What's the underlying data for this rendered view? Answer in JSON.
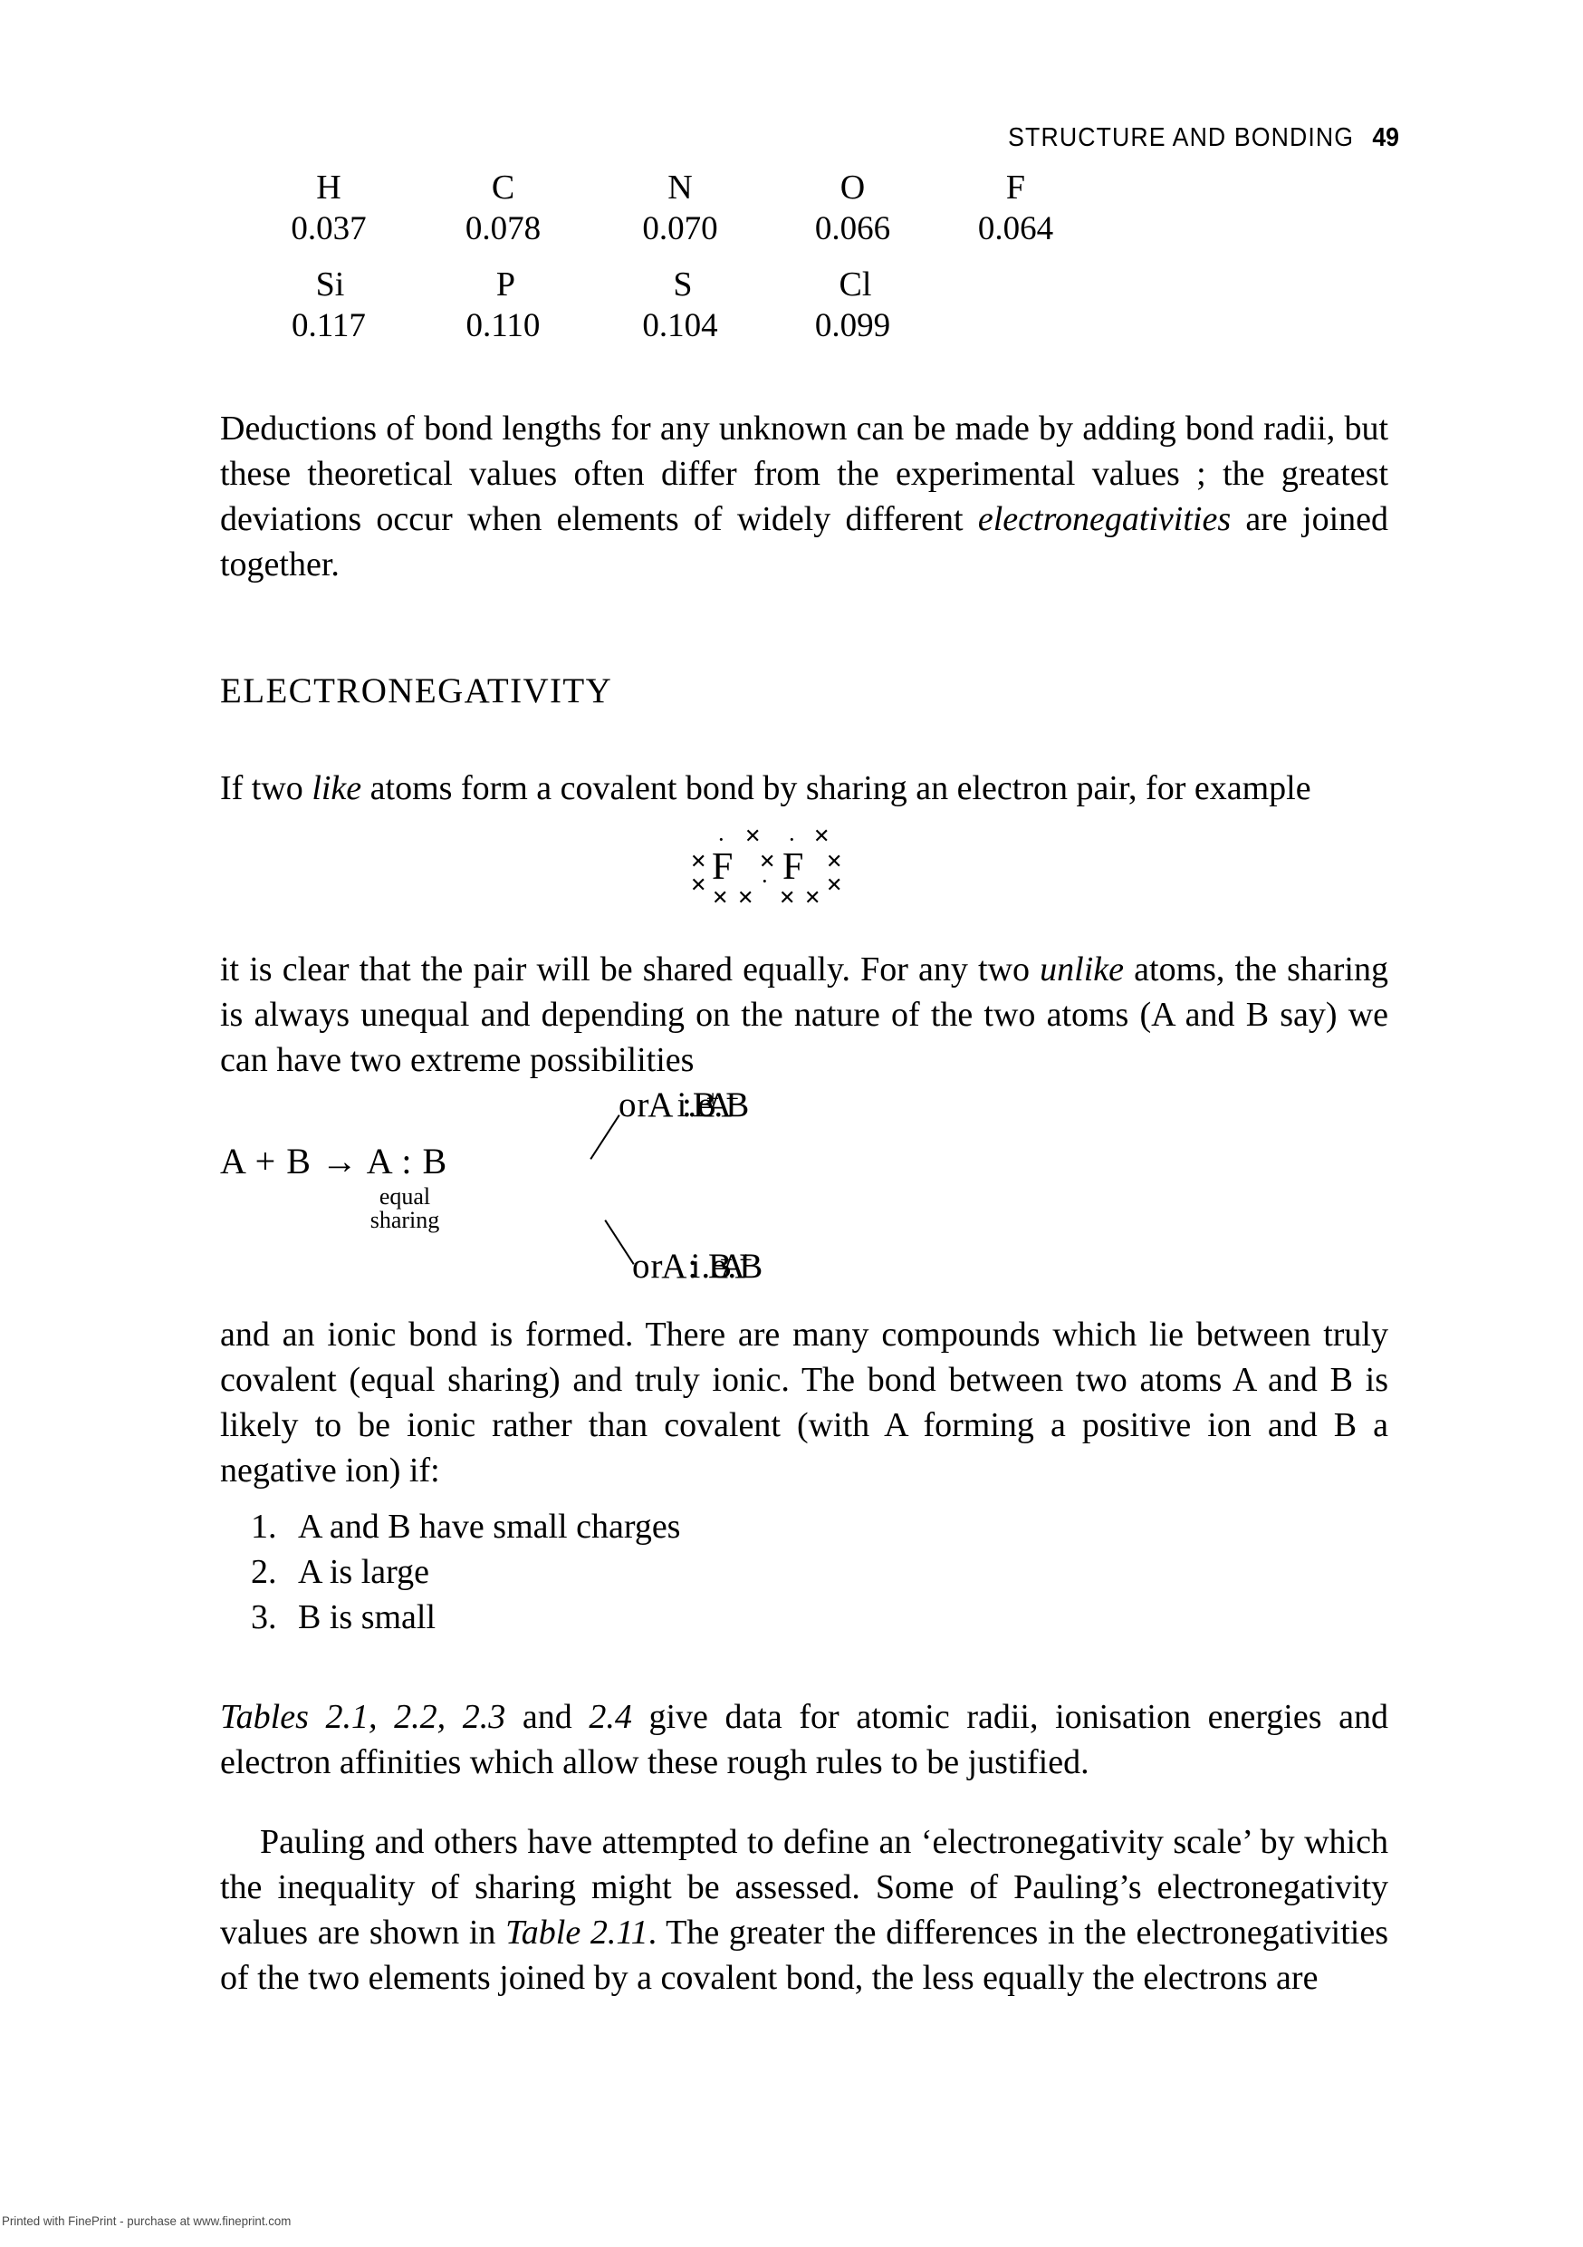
{
  "header": {
    "title": "STRUCTURE AND BONDING",
    "page_number": "49"
  },
  "bond_radii_table": {
    "row1": {
      "symbols": [
        "H",
        "C",
        "N",
        "O",
        "F"
      ],
      "values": [
        "0.037",
        "0.078",
        "0.070",
        "0.066",
        "0.064"
      ]
    },
    "row2": {
      "symbols": [
        "Si",
        "P",
        "S",
        "Cl"
      ],
      "values": [
        "0.117",
        "0.110",
        "0.104",
        "0.099"
      ]
    }
  },
  "paragraphs": {
    "deductions_1": "Deductions of bond lengths for any unknown can be made by adding bond radii, but these theoretical values often differ from the experimental values ; the greatest deviations occur when elements of widely different ",
    "deductions_italic": "electronegativities",
    "deductions_2": " are joined together.",
    "if_two_1": "If two ",
    "if_two_italic": "like",
    "if_two_2": " atoms form a covalent bond by sharing an electron pair, for example",
    "clear_1": "it is clear that the pair will be shared equally. For any two ",
    "clear_italic": "unlike",
    "clear_2": " atoms, the sharing is always unequal and depending on the nature of the two atoms (A and B say) we can have two extreme possibilities",
    "ionic_bond": "and an ionic bond is formed. There are many compounds which lie between truly covalent (equal sharing) and truly ionic. The bond between two atoms A and B is likely to be ionic rather than covalent (with A forming a positive ion and B a negative ion) if:",
    "tables_italic": "Tables 2.1, 2.2, 2.3",
    "tables_rest": " and ",
    "tables_italic2": "2.4",
    "tables_rest2": " give data for atomic radii, ionisation energies and electron affinities which allow these rough rules to be justified.",
    "pauling_1": "Pauling and others have attempted to define an ‘electronegativity scale’ by which the inequality of sharing might be assessed. Some of Pauling’s electronegativity values are shown in ",
    "pauling_italic": "Table 2.11",
    "pauling_2": ". The greater the differences in the electronegativities of the two elements joined by a covalent bond, the less equally the electrons are"
  },
  "section_heading": "ELECTRONEGATIVITY",
  "lewis_structure": {
    "atom_left": "F",
    "atom_right": "F",
    "marks": {
      "left_top_dot": "·",
      "left_top_cross": "✕",
      "left_upper_cross": "✕",
      "left_lower_cross": "✕",
      "left_bottom_cross_a": "✕",
      "left_bottom_cross_b": "✕",
      "shared_cross": "✕",
      "shared_dot": "·",
      "right_top_dot": "·",
      "right_top_cross": "✕",
      "right_upper_cross": "✕",
      "right_lower_cross": "✕",
      "right_bottom_cross_a": "✕",
      "right_bottom_cross_b": "✕"
    }
  },
  "scheme": {
    "main": "A + B → A : B",
    "label_line1": "equal",
    "label_line2": "sharing",
    "branch_top": {
      "or": "or",
      "formula": "A  :B",
      "ie": "i.e.",
      "ion_a": "A",
      "ion_a_charge": "+",
      "ion_b": "B",
      "ion_b_charge": "−"
    },
    "branch_bottom": {
      "or": "or",
      "formula": "A:  B",
      "ie": "i.e.",
      "ion_a": "A",
      "ion_a_charge": "−",
      "ion_b": "B",
      "ion_b_charge": "+"
    }
  },
  "numbered_list": [
    {
      "num": "1.",
      "text": "A and B have small charges"
    },
    {
      "num": "2.",
      "text": "A is large"
    },
    {
      "num": "3.",
      "text": "B is small"
    }
  ],
  "watermark": "Printed with FinePrint - purchase at www.fineprint.com"
}
